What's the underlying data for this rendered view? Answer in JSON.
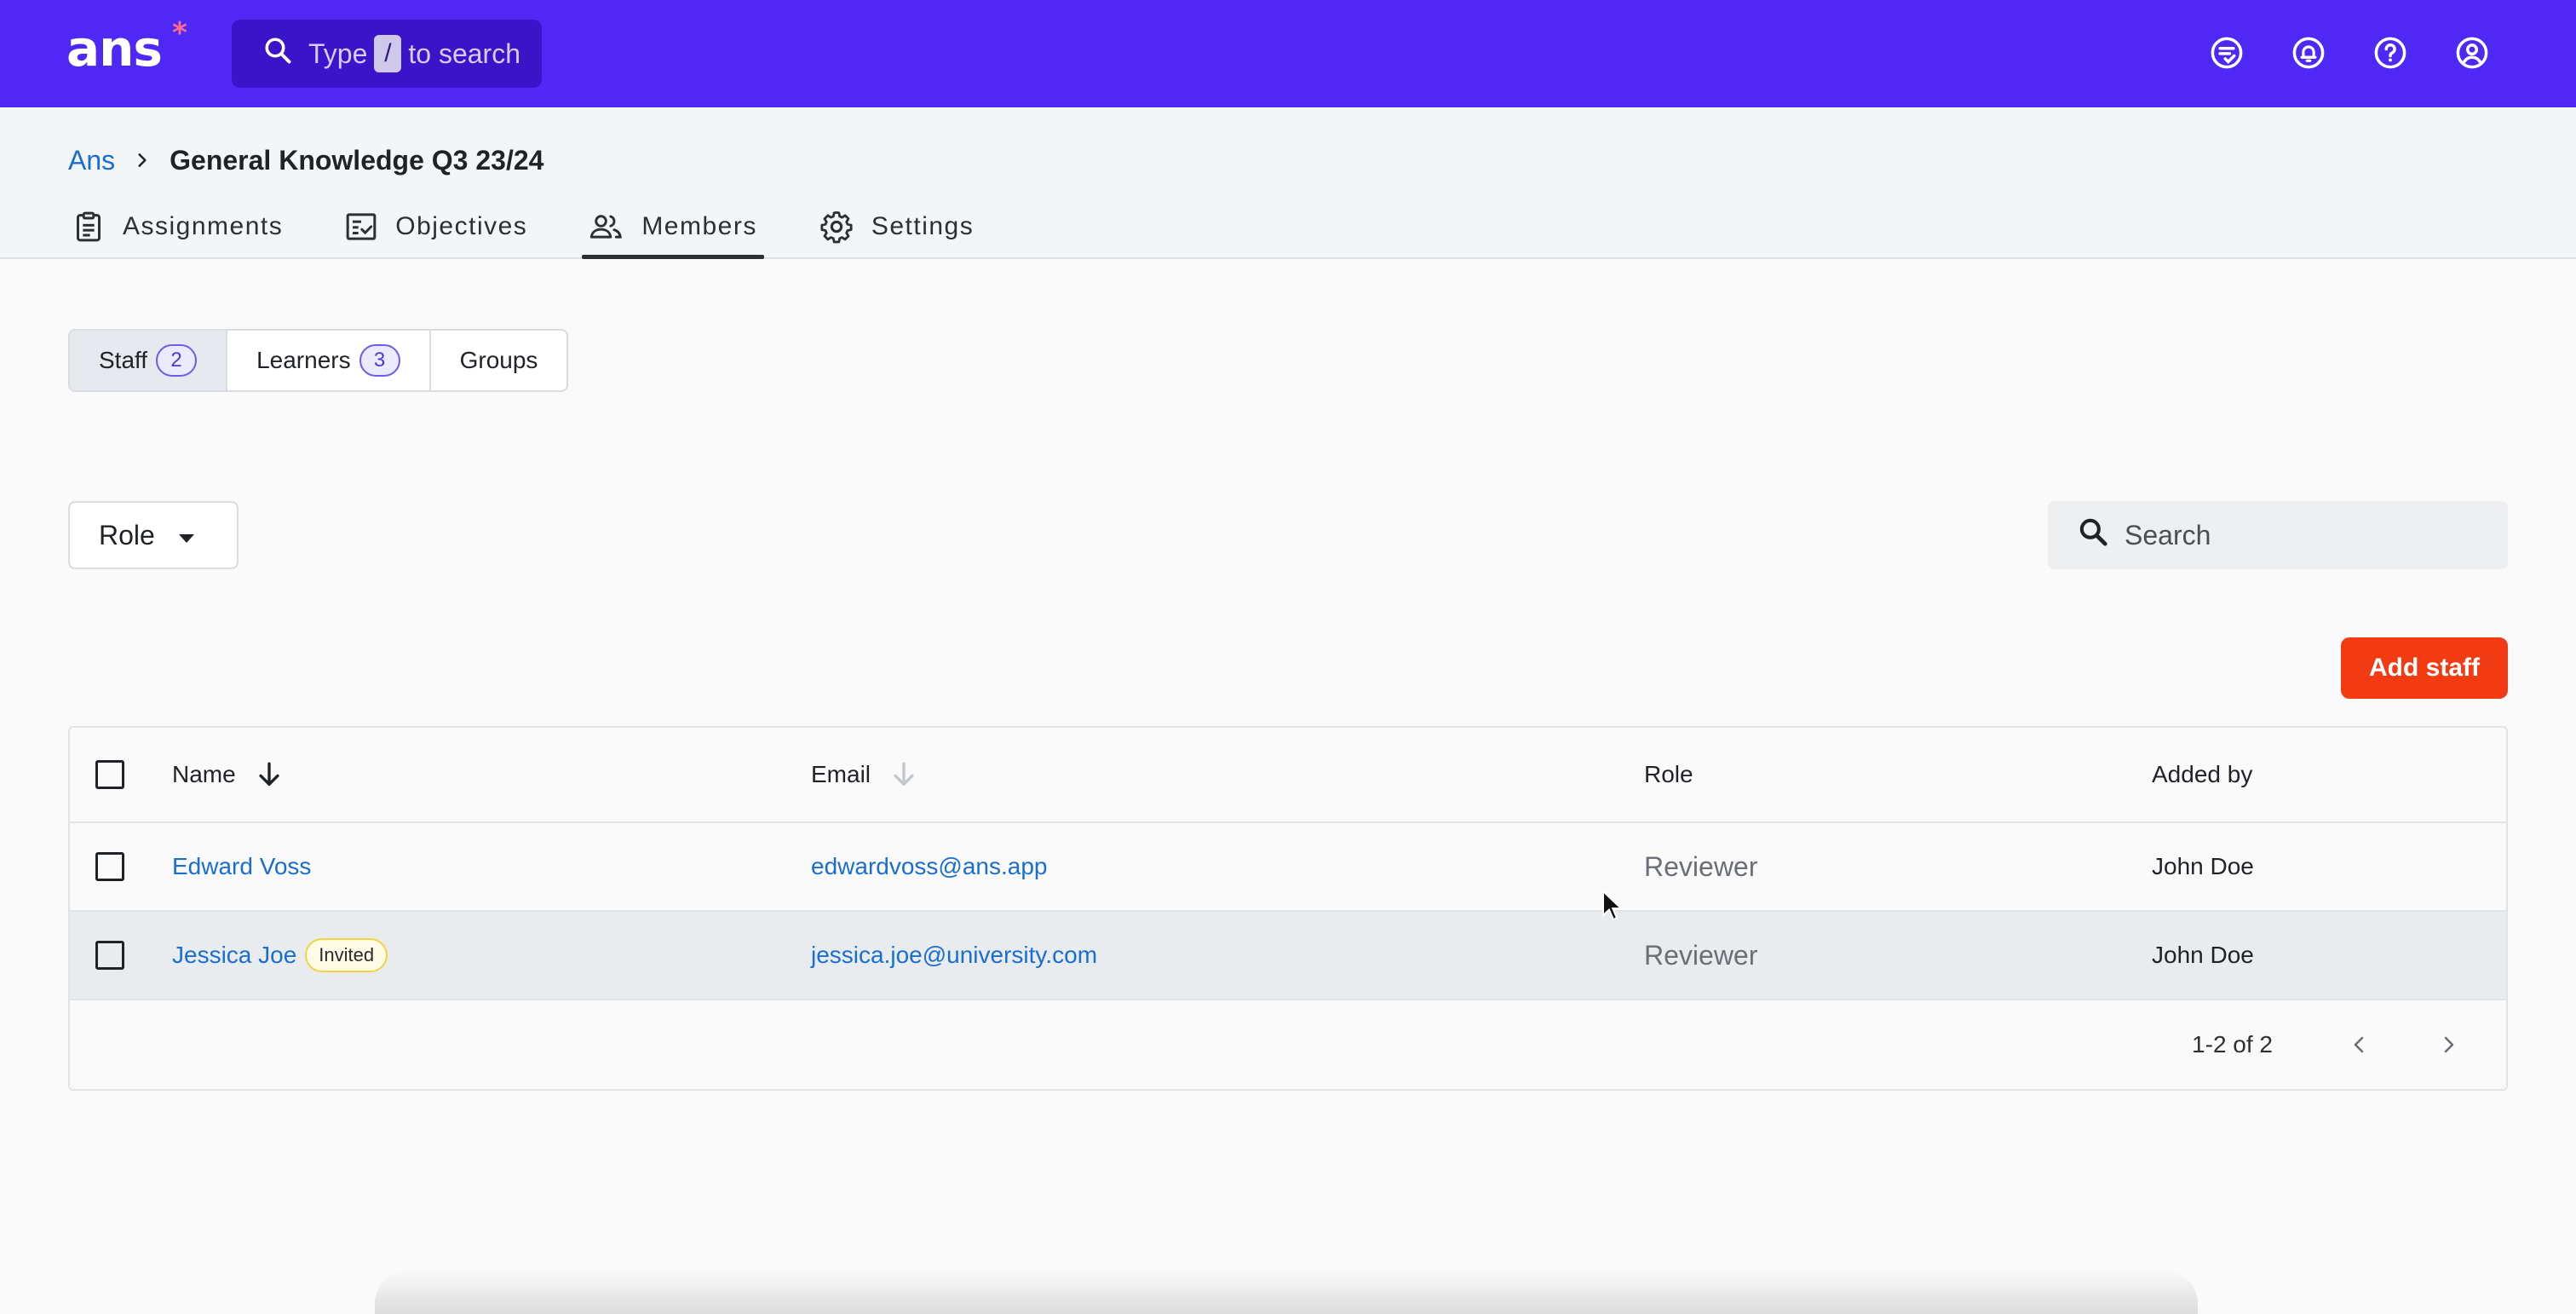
{
  "app": {
    "logo_text": "ans",
    "logo_star": "*",
    "brand_color": "#4f28f6",
    "accent_color": "#f33b13"
  },
  "topbar": {
    "search": {
      "prefix": "Type",
      "key": "/",
      "suffix": "to search"
    },
    "icons": [
      "tasks-icon",
      "bell-icon",
      "help-icon",
      "account-icon"
    ]
  },
  "breadcrumb": {
    "root": "Ans",
    "current": "General Knowledge Q3 23/24"
  },
  "tabs": [
    {
      "label": "Assignments",
      "icon": "clipboard-icon",
      "active": false
    },
    {
      "label": "Objectives",
      "icon": "checklist-icon",
      "active": false
    },
    {
      "label": "Members",
      "icon": "people-icon",
      "active": true
    },
    {
      "label": "Settings",
      "icon": "gear-icon",
      "active": false
    }
  ],
  "segments": [
    {
      "label": "Staff",
      "count": "2",
      "active": true
    },
    {
      "label": "Learners",
      "count": "3",
      "active": false
    },
    {
      "label": "Groups",
      "active": false
    }
  ],
  "filters": {
    "role_label": "Role",
    "search_placeholder": "Search"
  },
  "actions": {
    "add_staff": "Add staff"
  },
  "table": {
    "columns": [
      "Name",
      "Email",
      "Role",
      "Added by"
    ],
    "rows": [
      {
        "name": "Edward Voss",
        "email": "edwardvoss@ans.app",
        "role": "Reviewer",
        "added_by": "John Doe",
        "badge": ""
      },
      {
        "name": "Jessica Joe",
        "email": "jessica.joe@university.com",
        "role": "Reviewer",
        "added_by": "John Doe",
        "badge": "Invited"
      }
    ],
    "pagination": "1-2 of 2"
  }
}
